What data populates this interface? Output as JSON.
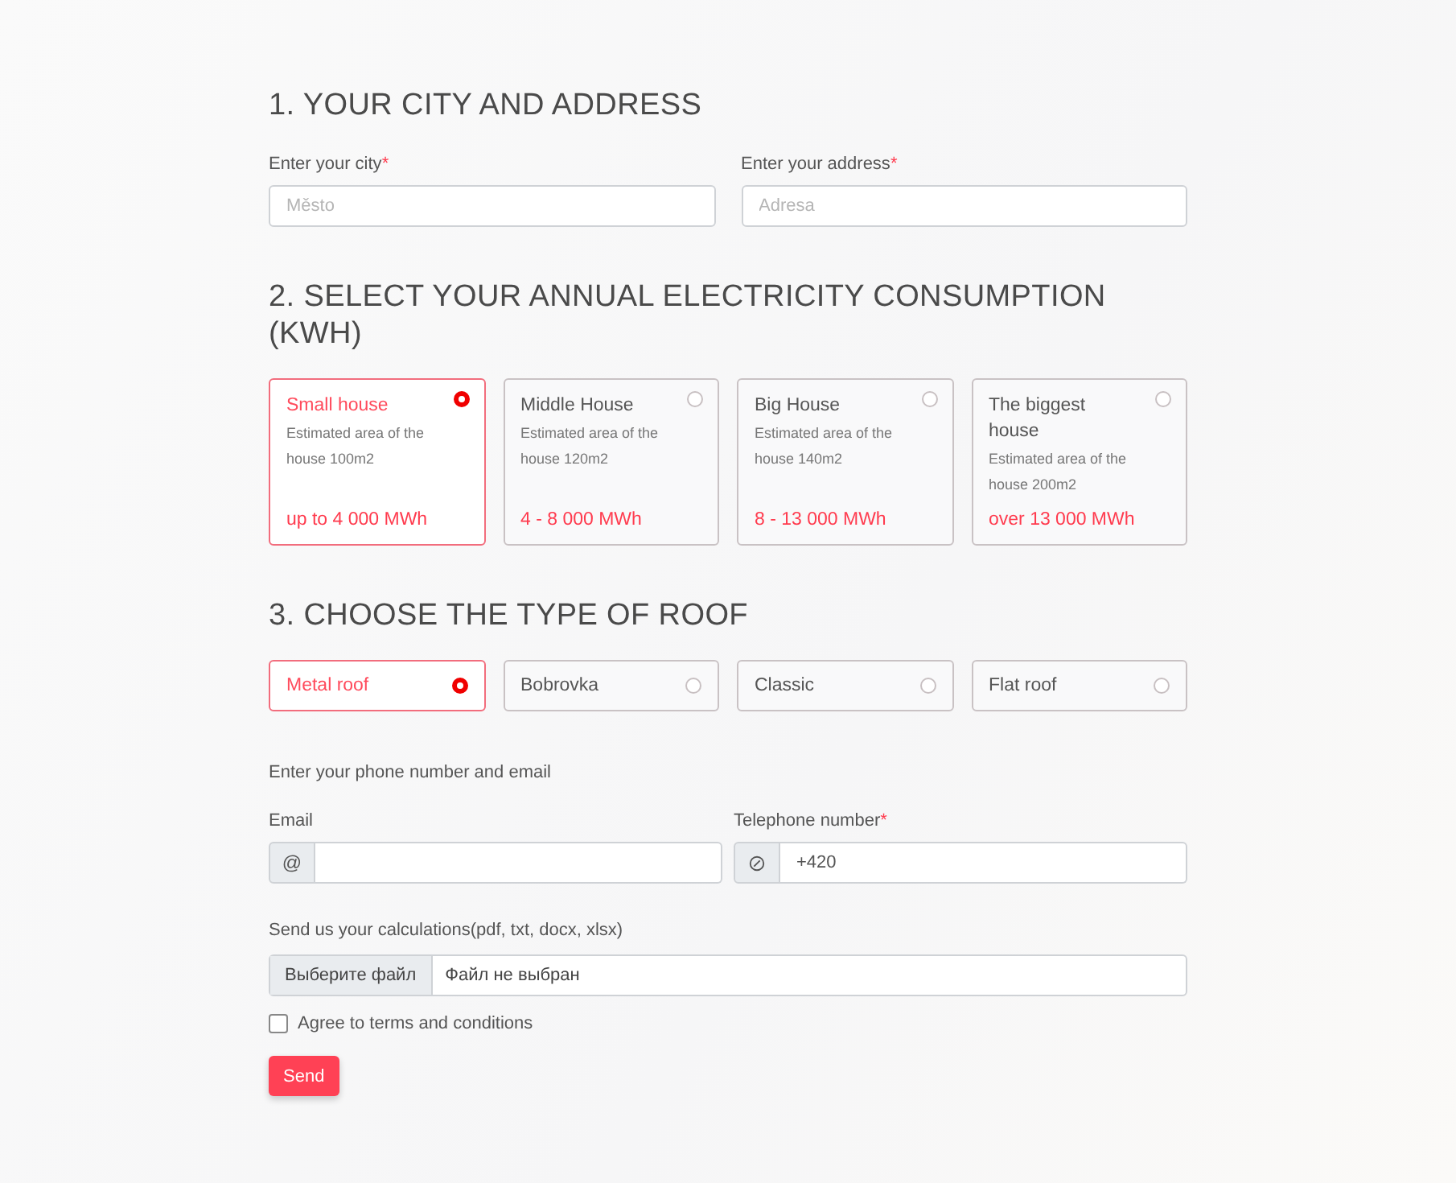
{
  "section_1": {
    "heading": "1. YOUR CITY AND ADDRESS",
    "fields": [
      {
        "label": "Enter your city",
        "required_mark": "*",
        "placeholder": "Město"
      },
      {
        "label": "Enter your address",
        "required_mark": "*",
        "placeholder": "Adresa"
      }
    ]
  },
  "section_2": {
    "heading": "2. SELECT YOUR ANNUAL ELECTRICITY CONSUMPTION (KWH)",
    "options": [
      {
        "title": "Small house",
        "description": "Estimated area of the house 100m2",
        "range": "up to 4 000 MWh",
        "selected": true
      },
      {
        "title": "Middle House",
        "description": "Estimated area of the house 120m2",
        "range": "4 - 8 000 MWh",
        "selected": false
      },
      {
        "title": "Big House",
        "description": "Estimated area of the house 140m2",
        "range": "8 - 13 000 MWh",
        "selected": false
      },
      {
        "title": "The biggest house",
        "description": "Estimated area of the house 200m2",
        "range": "over 13 000 MWh",
        "selected": false
      }
    ]
  },
  "section_3": {
    "heading": "3. CHOOSE THE TYPE OF ROOF",
    "options": [
      {
        "label": "Metal roof",
        "selected": true
      },
      {
        "label": "Bobrovka",
        "selected": false
      },
      {
        "label": "Classic",
        "selected": false
      },
      {
        "label": "Flat roof",
        "selected": false
      }
    ]
  },
  "contact": {
    "intro": "Enter your phone number and email",
    "fields": [
      {
        "kind": "email",
        "label": "Email",
        "addon": "@"
      },
      {
        "kind": "phone",
        "label": "Telephone number",
        "required_mark": "*",
        "value": "+420"
      }
    ]
  },
  "upload": {
    "label": "Send us your calculations(pdf, txt, docx, xlsx)",
    "button": "Выберите файл",
    "status": "Файл не выбран"
  },
  "agree": {
    "label": "Agree to terms and conditions",
    "checked": false
  },
  "submit": "Send"
}
